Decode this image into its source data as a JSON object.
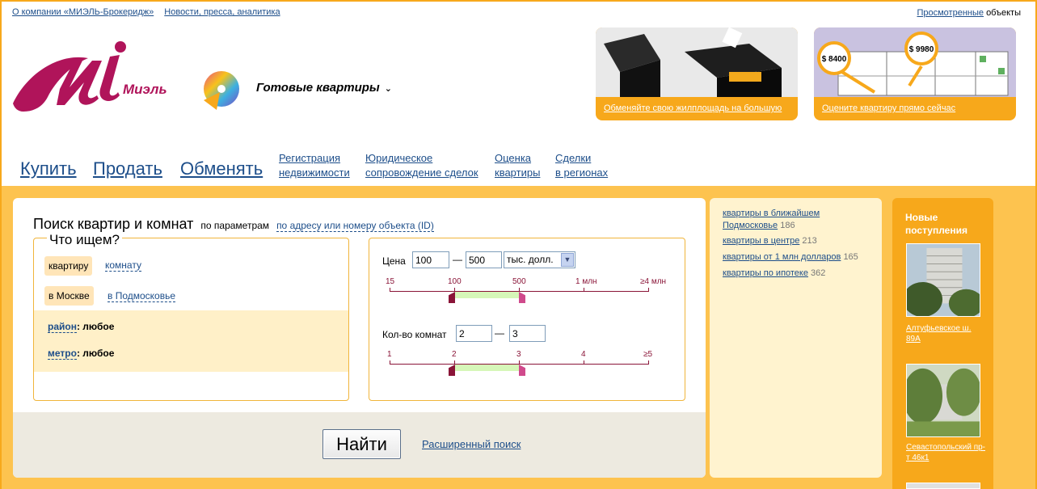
{
  "top_links": [
    "О компании «МИЭЛЬ-Брокеридж»",
    "Новости, пресса, аналитика"
  ],
  "viewed": {
    "link": "Просмотренные",
    "rest": "объекты"
  },
  "logo": {
    "brand": "Миэль",
    "brand_color": "#b0145a"
  },
  "section_title": "Готовые квартиры",
  "promos": [
    {
      "caption": "Обменяйте свою жилплощадь на большую"
    },
    {
      "caption": "Оцените квартиру прямо сейчас",
      "price_left": "$ 8400",
      "price_right": "$ 9980"
    }
  ],
  "nav": {
    "buy": "Купить",
    "sell": "Продать",
    "exchange": "Обменять",
    "reg_1": "Регистрация",
    "reg_2": "недвижимости",
    "legal_1": "Юридическое",
    "legal_2": "сопровождение сделок",
    "eval_1": "Оценка",
    "eval_2": "квартиры",
    "deals_1": "Сделки",
    "deals_2": "в регионах"
  },
  "search": {
    "title": "Поиск квартир и комнат",
    "by_params": "по параметрам",
    "by_address": "по адресу или номеру объекта (ID)",
    "what_legend": "Что ищем?",
    "type_selected": "квартиру",
    "type_other": "комнату",
    "region_selected": "в Москве",
    "region_other": "в Подмосковье",
    "district_key": "район",
    "district_value": ": любое",
    "metro_key": "метро",
    "metro_value": ": любое",
    "price_label": "Цена",
    "price_from": "100",
    "price_to": "500",
    "currency": "тыс. долл.",
    "price_ticks": [
      "15",
      "100",
      "500",
      "1 млн",
      "≥4 млн"
    ],
    "rooms_label": "Кол-во комнат",
    "rooms_from": "2",
    "rooms_to": "3",
    "room_ticks": [
      "1",
      "2",
      "3",
      "4",
      "≥5"
    ],
    "dash": "—",
    "find_button": "Найти",
    "advanced": "Расширенный поиск"
  },
  "quick_links": [
    {
      "label": "квартиры в ближайшем Подмосковье",
      "count": "186"
    },
    {
      "label": "квартиры в центре",
      "count": "213"
    },
    {
      "label": "квартиры от 1 млн долларов",
      "count": "165"
    },
    {
      "label": "квартиры по ипотеке",
      "count": "362"
    }
  ],
  "new_listings": {
    "title": "Новые поступления",
    "items": [
      {
        "address": "Алтуфьевское ш. 89А"
      },
      {
        "address": "Севастопольский пр-т 46к1"
      }
    ]
  },
  "colors": {
    "accent": "#f7a81b",
    "link": "#1d4e8a",
    "panel_bg": "#fdc34f",
    "slider": "#8a1538"
  }
}
